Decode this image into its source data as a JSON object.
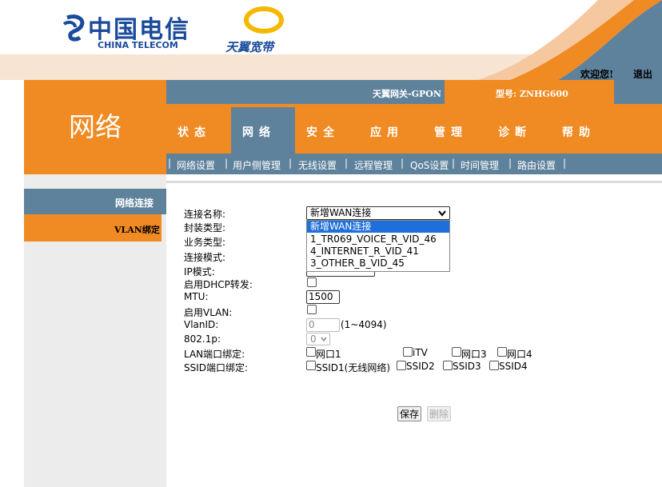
{
  "header": {
    "brand_cn": "中国电信",
    "brand_en": "CHINA TELECOM",
    "product_brand": "天翼宽带",
    "welcome": "欢迎您!",
    "logout": "退出"
  },
  "section_title": "网络",
  "info_bar": {
    "gateway_name": "天翼网关-GPON",
    "model": "型号: ZNHG600"
  },
  "nav": {
    "items": [
      "状态",
      "网络",
      "安全",
      "应用",
      "管理",
      "诊断",
      "帮助"
    ],
    "active": "网络"
  },
  "subnav": {
    "items": [
      "网络设置",
      "用户侧管理",
      "无线设置",
      "远程管理",
      "QoS设置",
      "时间管理",
      "路由设置"
    ]
  },
  "sidebar": {
    "items": [
      "网络连接",
      "VLAN绑定"
    ]
  },
  "form": {
    "labels": {
      "connection_name": "连接名称:",
      "encapsulation": "封装类型:",
      "service_type": "业务类型:",
      "connection_mode": "连接模式:",
      "ip_mode": "IP模式:",
      "enable_dhcp": "启用DHCP转发:",
      "mtu": "MTU:",
      "enable_vlan": "启用VLAN:",
      "vlan_id": "VlanID:",
      "dot1p": "802.1p:",
      "lan_binding": "LAN端口绑定:",
      "ssid_binding": "SSID端口绑定:"
    },
    "connection_select_value": "新增WAN连接",
    "connection_options": [
      "新增WAN连接",
      "1_TR069_VOICE_R_VID_46",
      "4_INTERNET_R_VID_41",
      "3_OTHER_B_VID_45"
    ],
    "mtu_value": "1500",
    "vlan_id_value": "0",
    "vlan_id_hint": "(1~4094)",
    "dot1p_value": "0",
    "lan_ports": [
      "网口1",
      "iTV",
      "网口3",
      "网口4"
    ],
    "ssids": [
      "SSID1(无线网络)",
      "SSID2",
      "SSID3",
      "SSID4"
    ],
    "save_label": "保存",
    "delete_label": "删除"
  },
  "colors": {
    "orange": "#f08a22",
    "steel_blue": "#5f829c",
    "brand_blue": "#1a4a9a"
  }
}
